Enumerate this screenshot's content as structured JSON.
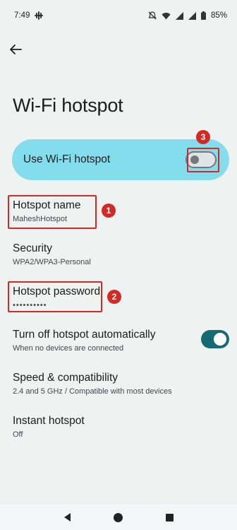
{
  "status_bar": {
    "time": "7:49",
    "battery_percent": "85%",
    "icons": [
      "slack-icon",
      "mute-icon",
      "wifi-icon",
      "signal-icon",
      "signal-icon-2",
      "battery-icon"
    ]
  },
  "header": {
    "title": "Wi-Fi hotspot"
  },
  "master_switch": {
    "label": "Use Wi-Fi hotspot",
    "enabled": false
  },
  "settings": [
    {
      "title": "Hotspot name",
      "subtitle": "MaheshHotspot"
    },
    {
      "title": "Security",
      "subtitle": "WPA2/WPA3-Personal"
    },
    {
      "title": "Hotspot password",
      "subtitle": "••••••••••"
    },
    {
      "title": "Turn off hotspot automatically",
      "subtitle": "When no devices are connected",
      "toggle": true
    },
    {
      "title": "Speed & compatibility",
      "subtitle": "2.4 and 5 GHz / Compatible with most devices"
    },
    {
      "title": "Instant hotspot",
      "subtitle": "Off"
    }
  ],
  "annotations": {
    "marker_1": "1",
    "marker_2": "2",
    "marker_3": "3"
  },
  "colors": {
    "background": "#eef2f1",
    "master_card": "#83dded",
    "toggle_on": "#146b73",
    "annotation_red": "#d42a26"
  }
}
